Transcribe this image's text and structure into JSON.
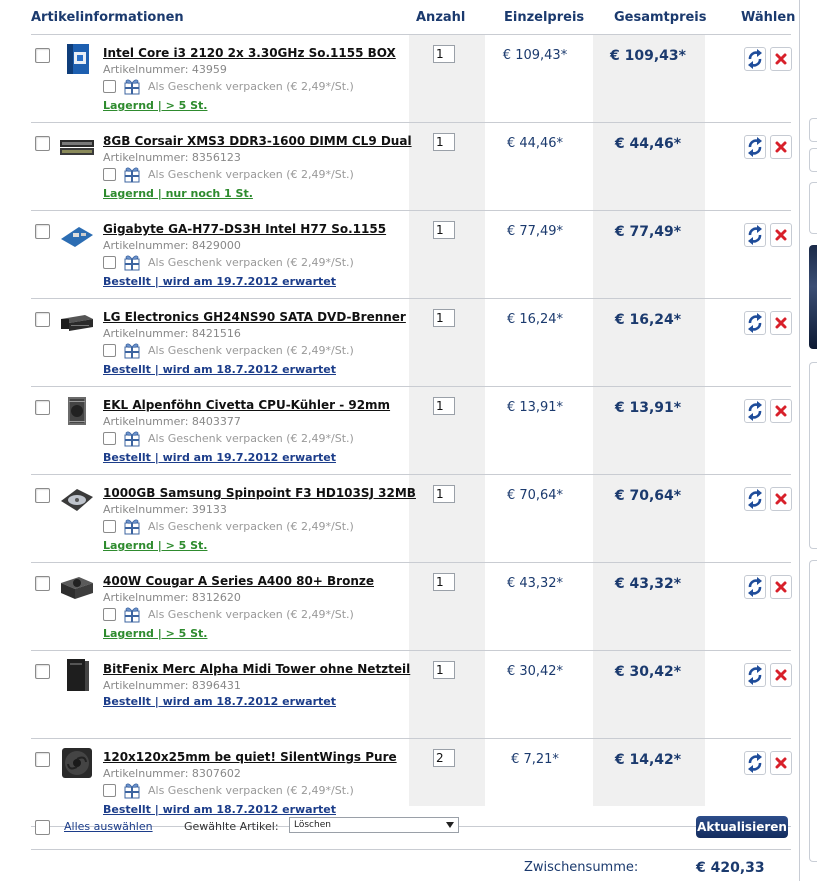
{
  "header": {
    "col_info": "Artikelinformationen",
    "col_qty": "Anzahl",
    "col_unit": "Einzelpreis",
    "col_total": "Gesamtpreis",
    "col_select": "Wählen"
  },
  "gift_label": "Als Geschenk verpacken (€ 2,49*/St.)",
  "items": [
    {
      "title": "Intel Core i3 2120 2x 3.30GHz So.1155 BOX",
      "artnr": "Artikelnummer: 43959",
      "gift": true,
      "stock": "Lagernd | > 5 St.",
      "stock_status": "green",
      "qty": "1",
      "unit": "€ 109,43*",
      "total": "€ 109,43*",
      "thumb": "cpu-box"
    },
    {
      "title": "8GB Corsair XMS3 DDR3-1600 DIMM CL9 Dual",
      "artnr": "Artikelnummer: 8356123",
      "gift": true,
      "stock": "Lagernd | nur noch 1 St.",
      "stock_status": "green",
      "qty": "1",
      "unit": "€ 44,46*",
      "total": "€ 44,46*",
      "thumb": "ram"
    },
    {
      "title": "Gigabyte GA-H77-DS3H Intel H77 So.1155",
      "artnr": "Artikelnummer: 8429000",
      "gift": true,
      "stock": "Bestellt | wird am 19.7.2012 erwartet",
      "stock_status": "blue",
      "qty": "1",
      "unit": "€ 77,49*",
      "total": "€ 77,49*",
      "thumb": "mainboard"
    },
    {
      "title": "LG Electronics GH24NS90 SATA DVD-Brenner",
      "artnr": "Artikelnummer: 8421516",
      "gift": true,
      "stock": "Bestellt | wird am 18.7.2012 erwartet",
      "stock_status": "blue",
      "qty": "1",
      "unit": "€ 16,24*",
      "total": "€ 16,24*",
      "thumb": "dvd"
    },
    {
      "title": "EKL Alpenföhn Civetta CPU-Kühler - 92mm",
      "artnr": "Artikelnummer: 8403377",
      "gift": true,
      "stock": "Bestellt | wird am 19.7.2012 erwartet",
      "stock_status": "blue",
      "qty": "1",
      "unit": "€ 13,91*",
      "total": "€ 13,91*",
      "thumb": "cooler"
    },
    {
      "title": "1000GB Samsung Spinpoint F3 HD103SJ 32MB",
      "artnr": "Artikelnummer: 39133",
      "gift": true,
      "stock": "Lagernd | > 5 St.",
      "stock_status": "green",
      "qty": "1",
      "unit": "€ 70,64*",
      "total": "€ 70,64*",
      "thumb": "hdd"
    },
    {
      "title": "400W Cougar A Series A400 80+ Bronze",
      "artnr": "Artikelnummer: 8312620",
      "gift": true,
      "stock": "Lagernd | > 5 St.",
      "stock_status": "green",
      "qty": "1",
      "unit": "€ 43,32*",
      "total": "€ 43,32*",
      "thumb": "psu"
    },
    {
      "title": "BitFenix Merc Alpha Midi Tower ohne Netzteil",
      "artnr": "Artikelnummer: 8396431",
      "gift": false,
      "stock": "Bestellt | wird am 18.7.2012 erwartet",
      "stock_status": "blue",
      "qty": "1",
      "unit": "€ 30,42*",
      "total": "€ 30,42*",
      "thumb": "case"
    },
    {
      "title": "120x120x25mm be quiet! SilentWings Pure",
      "artnr": "Artikelnummer: 8307602",
      "gift": true,
      "stock": "Bestellt | wird am 18.7.2012 erwartet",
      "stock_status": "blue",
      "qty": "2",
      "unit": "€ 7,21*",
      "total": "€ 14,42*",
      "thumb": "fan"
    }
  ],
  "footer": {
    "select_all": "Alles auswählen",
    "selected_label": "Gewählte Artikel:",
    "action_value": "Löschen",
    "update_button": "Aktualisieren"
  },
  "summary": {
    "subtotal_label": "Zwischensumme:",
    "subtotal_value": "€ 420,33"
  },
  "colors": {
    "heading": "#1b3a6e",
    "in_stock": "#2e8b2e",
    "ordered": "#1c3d8a",
    "delete": "#d8202a"
  }
}
